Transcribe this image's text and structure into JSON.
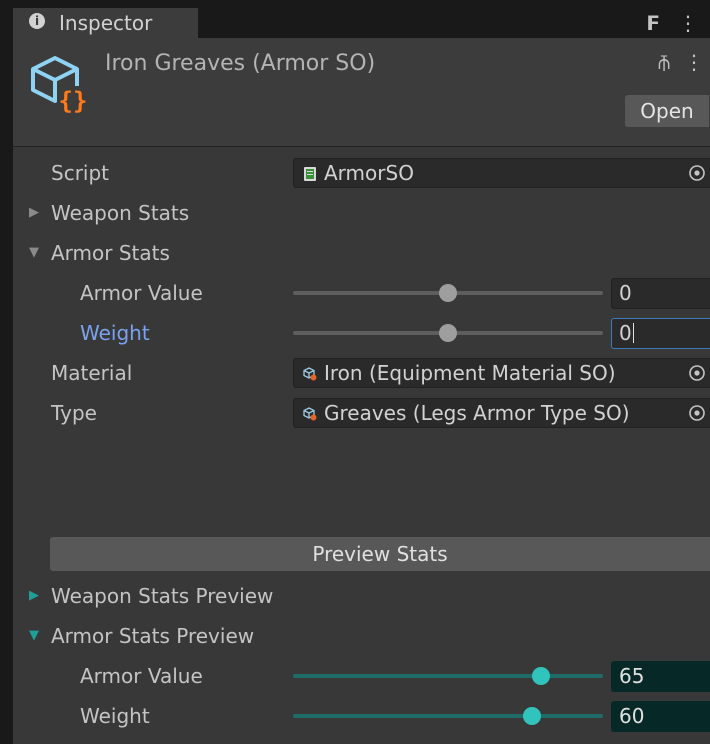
{
  "tab": {
    "title": "Inspector"
  },
  "header": {
    "asset_title": "Iron Greaves (Armor SO)",
    "open_label": "Open"
  },
  "fields": {
    "script": {
      "label": "Script",
      "value": "ArmorSO"
    },
    "weapon_stats": {
      "label": "Weapon Stats",
      "expanded": false
    },
    "armor_stats": {
      "label": "Armor Stats",
      "expanded": true,
      "armor_value": {
        "label": "Armor Value",
        "value": "0",
        "slider_fraction": 0.5
      },
      "weight": {
        "label": "Weight",
        "value": "0",
        "slider_fraction": 0.5
      }
    },
    "material": {
      "label": "Material",
      "value": "Iron (Equipment Material SO)"
    },
    "type": {
      "label": "Type",
      "value": "Greaves (Legs Armor Type SO)"
    }
  },
  "preview": {
    "button_label": "Preview Stats",
    "weapon_stats_preview": {
      "label": "Weapon Stats Preview",
      "expanded": false
    },
    "armor_stats_preview": {
      "label": "Armor Stats Preview",
      "expanded": true,
      "armor_value": {
        "label": "Armor Value",
        "value": "65",
        "slider_fraction": 0.8
      },
      "weight": {
        "label": "Weight",
        "value": "60",
        "slider_fraction": 0.77
      }
    }
  },
  "colors": {
    "background": "#383838",
    "accent_teal": "#31c4bc",
    "focus_blue": "#7aa2ef"
  },
  "icons": [
    "info-icon",
    "lock-icon",
    "kebab-menu-icon",
    "scriptable-object-icon",
    "settings-sliders-icon",
    "script-file-icon",
    "object-picker-icon",
    "foldout-arrow-icon"
  ]
}
